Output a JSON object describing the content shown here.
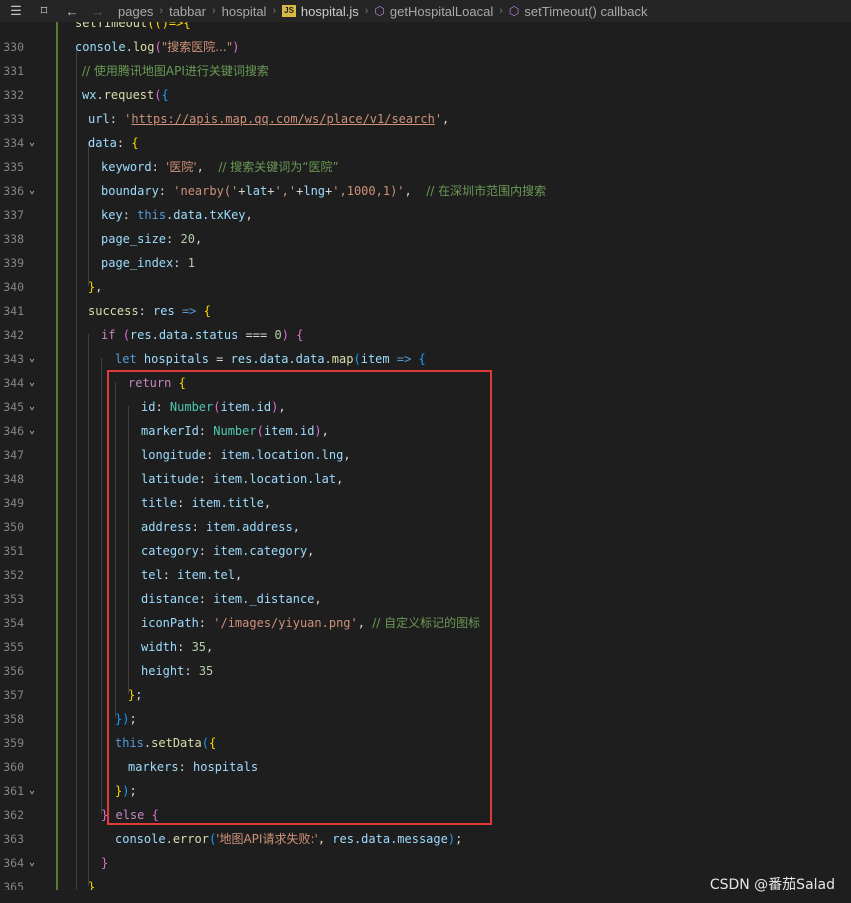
{
  "breadcrumb": {
    "items": [
      "pages",
      "tabbar",
      "hospital",
      "hospital.js",
      "getHospitalLoacal",
      "setTimeout() callback"
    ]
  },
  "line_numbers": [
    "330",
    "331",
    "332",
    "333",
    "334",
    "335",
    "336",
    "337",
    "338",
    "339",
    "340",
    "341",
    "342",
    "343",
    "344",
    "345",
    "346",
    "347",
    "348",
    "349",
    "350",
    "351",
    "352",
    "353",
    "354",
    "355",
    "356",
    "357",
    "358",
    "359",
    "360",
    "361",
    "362",
    "363",
    "364",
    "365"
  ],
  "code": {
    "l330_a": "setTimeout",
    "l330_b": "(()=>",
    "l331_fn": "console",
    "l331_log": "log",
    "l331_str": "\"搜索医院...\"",
    "l332_cmt": "// 使用腾讯地图API进行关键词搜索",
    "l333_obj": "wx",
    "l333_fn": "request",
    "l334_key": "url",
    "l334_url": "https://apis.map.qq.com/ws/place/v1/search",
    "l335_key": "data",
    "l336_key": "keyword",
    "l336_str": "'医院'",
    "l336_cmt": "// 搜索关键词为“医院”",
    "l337_key": "boundary",
    "l337_s1": "'nearby('",
    "l337_v1": "lat",
    "l337_s2": "','",
    "l337_v2": "lng",
    "l337_s3": "',1000,1)'",
    "l337_cmt": "// 在深圳市范围内搜索",
    "l338_key": "key",
    "l338_this": "this",
    "l338_rest": "data.txKey",
    "l339_key": "page_size",
    "l339_num": "20",
    "l340_key": "page_index",
    "l340_num": "1",
    "l342_key": "success",
    "l342_param": "res",
    "l343_if": "if",
    "l343_expr": "res.data.status",
    "l343_op": "===",
    "l343_num": "0",
    "l344_let": "let",
    "l344_var": "hospitals",
    "l344_expr": "res.data.data.",
    "l344_map": "map",
    "l344_param": "item",
    "l345_ret": "return",
    "l346_key": "id",
    "l346_fn": "Number",
    "l346_arg": "item.id",
    "l347_key": "markerId",
    "l347_fn": "Number",
    "l347_arg": "item.id",
    "l348_key": "longitude",
    "l348_val": "item.location.lng",
    "l349_key": "latitude",
    "l349_val": "item.location.lat",
    "l350_key": "title",
    "l350_val": "item.title",
    "l351_key": "address",
    "l351_val": "item.address",
    "l352_key": "category",
    "l352_val": "item.category",
    "l353_key": "tel",
    "l353_val": "item.tel",
    "l354_key": "distance",
    "l354_val": "item._distance",
    "l355_key": "iconPath",
    "l355_str": "'/images/yiyuan.png'",
    "l355_cmt": "// 自定义标记的图标",
    "l356_key": "width",
    "l356_num": "35",
    "l357_key": "height",
    "l357_num": "35",
    "l360_this": "this",
    "l360_fn": "setData",
    "l361_key": "markers",
    "l361_val": "hospitals",
    "l363_else": "else",
    "l364_obj": "console",
    "l364_fn": "error",
    "l364_str": "'地图API请求失败:'",
    "l364_rest": "res.data.message"
  },
  "watermark": "CSDN @番茄Salad",
  "colors": {
    "keyword": "#569cd6",
    "control": "#c586c0",
    "string": "#ce9178",
    "number": "#b5cea8",
    "comment": "#6a9955",
    "highlight_box": "#e03b3b"
  }
}
